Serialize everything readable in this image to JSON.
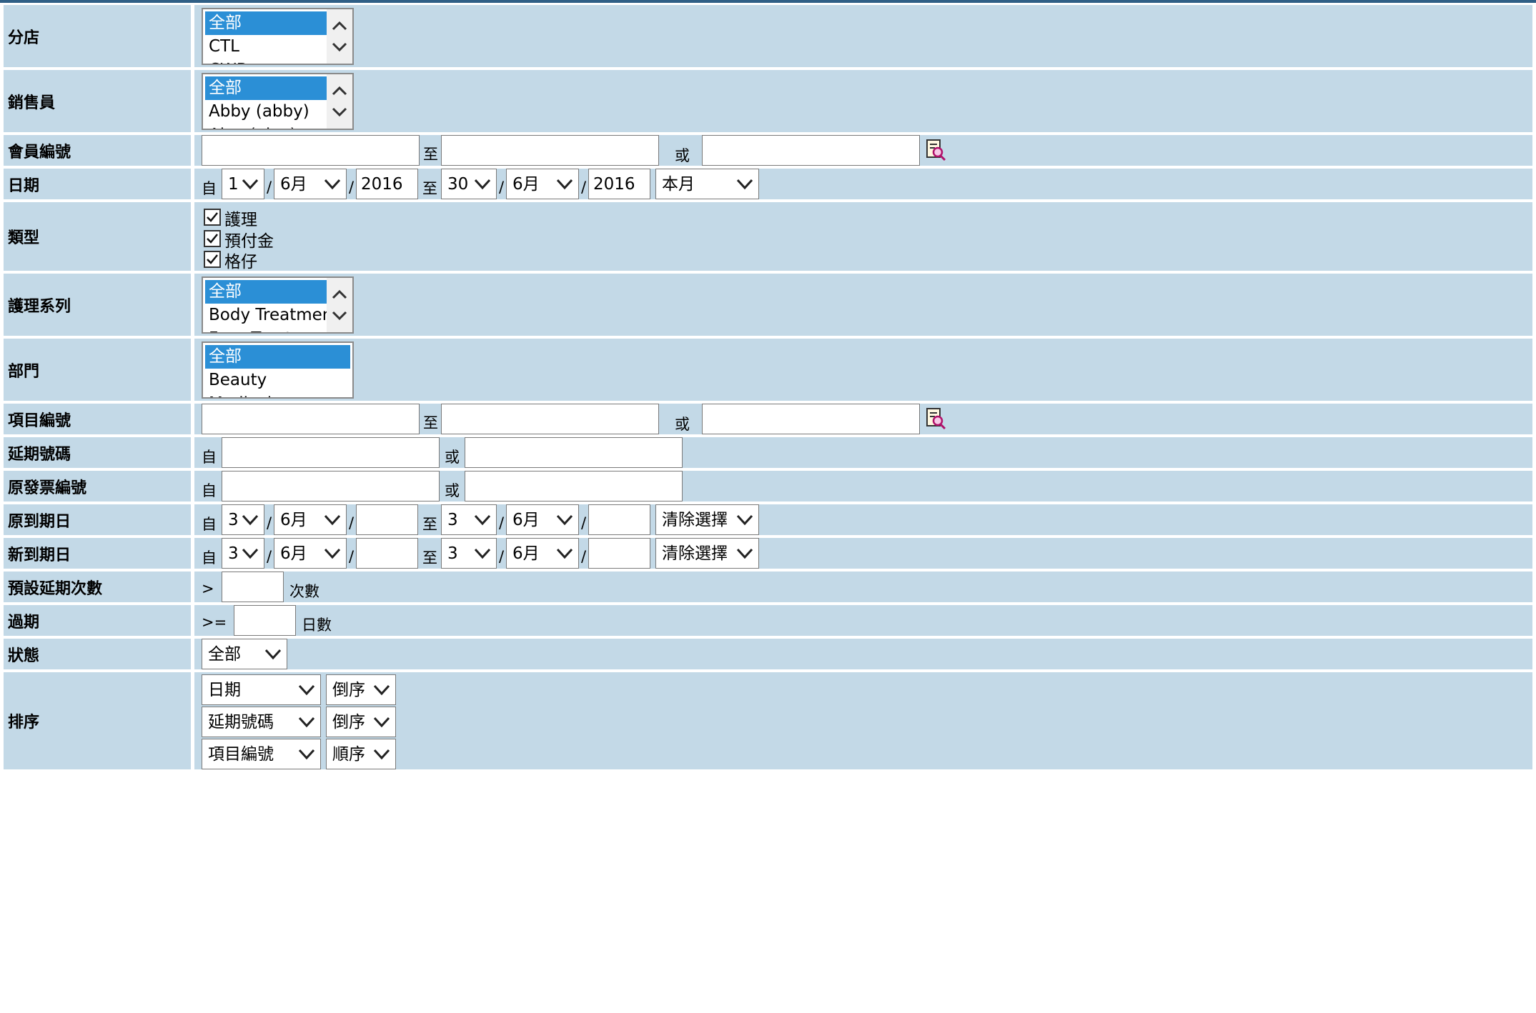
{
  "rows": {
    "branch": {
      "label": "分店",
      "options": [
        "全部",
        "CTL",
        "CWB"
      ]
    },
    "salesperson": {
      "label": "銷售員",
      "options": [
        "全部",
        "Abby (abby)",
        "Alex (alex)"
      ]
    },
    "member_no": {
      "label": "會員編號",
      "to": "至",
      "or": "或"
    },
    "date": {
      "label": "日期",
      "from": "自",
      "to": "至",
      "sep": "/",
      "from_day": "1",
      "from_month": "6月",
      "from_year": "2016",
      "to_day": "30",
      "to_month": "6月",
      "to_year": "2016",
      "preset": "本月"
    },
    "type": {
      "label": "類型",
      "items": [
        "護理",
        "預付金",
        "格仔"
      ]
    },
    "treatment_series": {
      "label": "護理系列",
      "options": [
        "全部",
        "Body Treatment",
        "Face Treatment"
      ]
    },
    "department": {
      "label": "部門",
      "options": [
        "全部",
        "Beauty",
        "Medical"
      ]
    },
    "item_no": {
      "label": "項目編號",
      "to": "至",
      "or": "或"
    },
    "extension_no": {
      "label": "延期號碼",
      "from": "自",
      "or": "或"
    },
    "original_invoice_no": {
      "label": "原發票編號",
      "from": "自",
      "or": "或"
    },
    "original_due_date": {
      "label": "原到期日",
      "from": "自",
      "to": "至",
      "sep": "/",
      "from_day": "3",
      "from_month": "6月",
      "to_day": "3",
      "to_month": "6月",
      "preset": "清除選擇"
    },
    "new_due_date": {
      "label": "新到期日",
      "from": "自",
      "to": "至",
      "sep": "/",
      "from_day": "3",
      "from_month": "6月",
      "to_day": "3",
      "to_month": "6月",
      "preset": "清除選擇"
    },
    "default_extension_count": {
      "label": "預設延期次數",
      "op": ">",
      "unit": "次數"
    },
    "overdue": {
      "label": "過期",
      "op": ">=",
      "unit": "日數"
    },
    "status": {
      "label": "狀態",
      "value": "全部"
    },
    "sort": {
      "label": "排序",
      "rows": [
        {
          "field": "日期",
          "order": "倒序"
        },
        {
          "field": "延期號碼",
          "order": "倒序"
        },
        {
          "field": "項目編號",
          "order": "順序"
        }
      ]
    }
  },
  "icons": {
    "lookup": "lookup-search-icon",
    "dropdown": "chevron-down-icon",
    "scroll_up": "chevron-up-icon",
    "scroll_down": "chevron-down-icon",
    "checkbox": "checkmark-icon"
  },
  "colors": {
    "row_bg": "#c3d9e7",
    "selected": "#2b8fd6",
    "top_line": "#2f5f86"
  }
}
